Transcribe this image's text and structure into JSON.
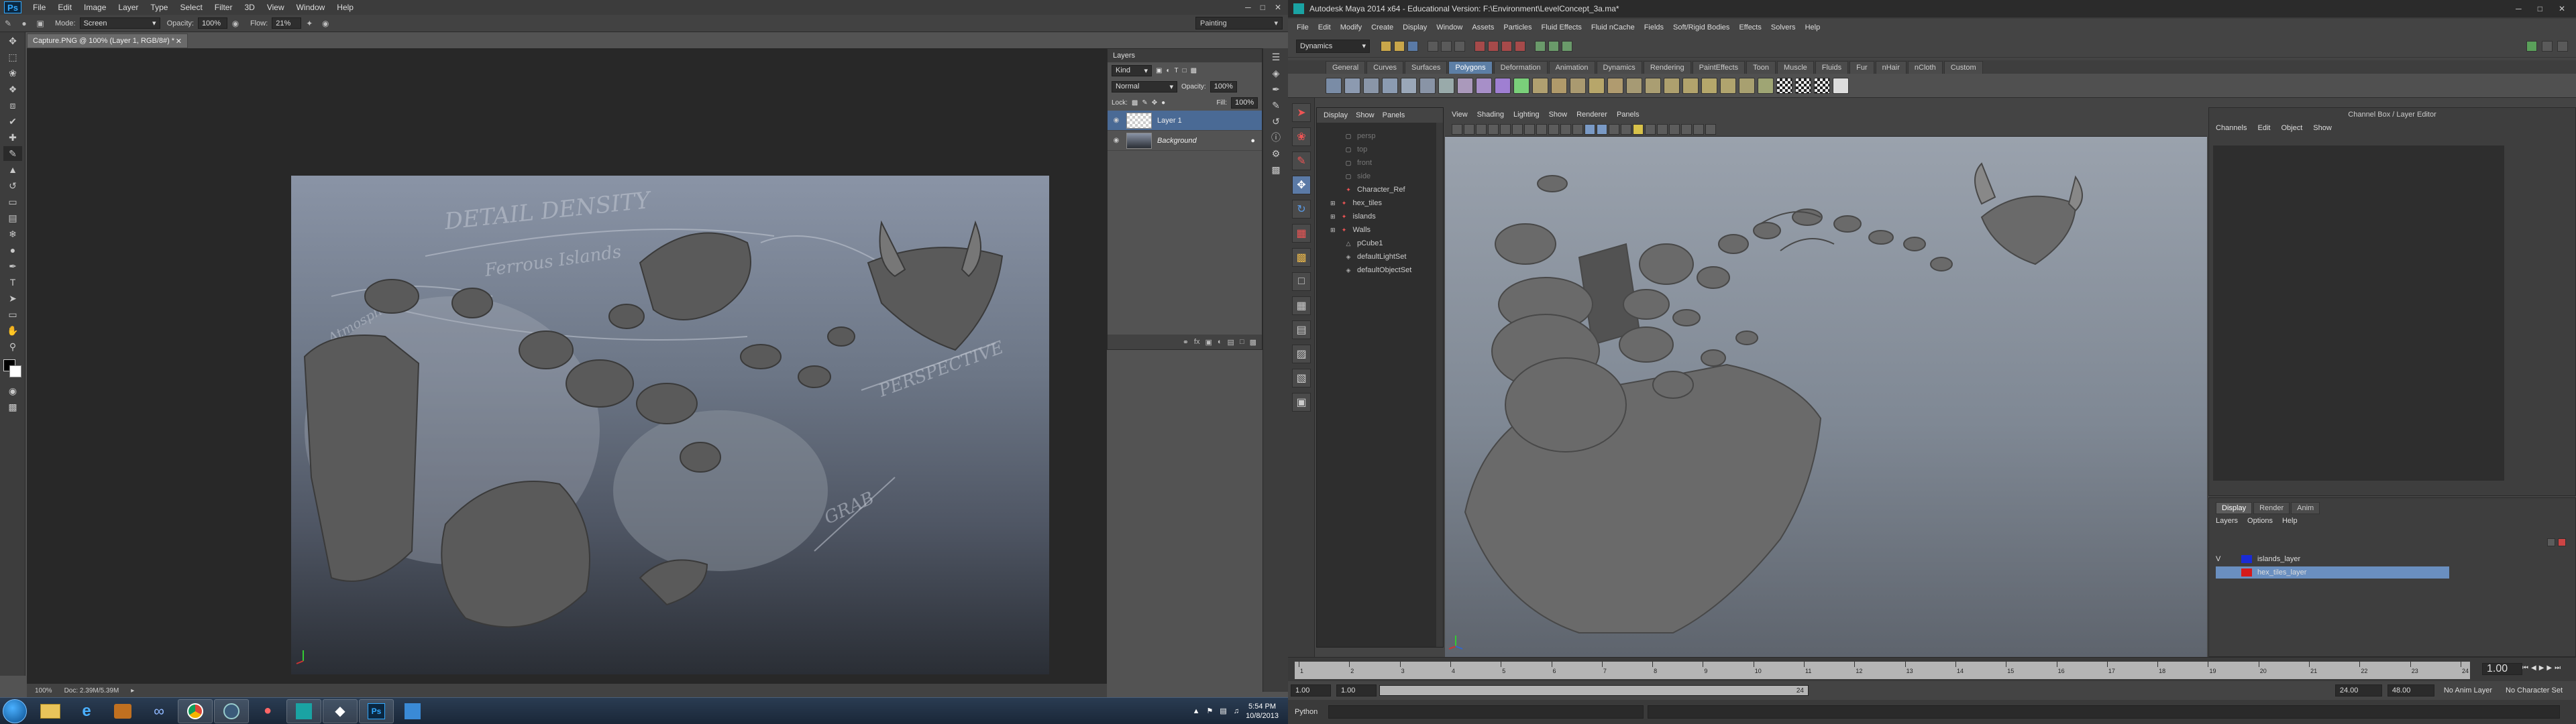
{
  "photoshop": {
    "logo": "Ps",
    "menu": [
      "File",
      "Edit",
      "Image",
      "Layer",
      "Type",
      "Select",
      "Filter",
      "3D",
      "View",
      "Window",
      "Help"
    ],
    "options": {
      "mode_label": "Mode:",
      "mode_value": "Screen",
      "opacity_label": "Opacity:",
      "opacity_value": "100%",
      "flow_label": "Flow:",
      "flow_value": "21%",
      "workspace": "Painting"
    },
    "document_tab": "Capture.PNG @ 100% (Layer 1, RGB/8#) *",
    "status": {
      "zoom": "100%",
      "doc": "Doc: 2.39M/5.39M"
    },
    "layers_panel": {
      "title": "Layers",
      "filter_kind": "Kind",
      "blend_mode": "Normal",
      "opacity_label": "Opacity:",
      "opacity_value": "100%",
      "lock_label": "Lock:",
      "fill_label": "Fill:",
      "fill_value": "100%",
      "layers": [
        {
          "name": "Layer 1"
        },
        {
          "name": "Background"
        }
      ]
    },
    "sketch_notes": [
      "DETAIL DENSITY",
      "Ferrous Islands",
      "PERSPECTIVE",
      "GRAB",
      "Atmosphere"
    ]
  },
  "maya": {
    "title": "Autodesk Maya 2014 x64 - Educational Version: F:\\Environment\\LevelConcept_3a.ma*",
    "menu": [
      "File",
      "Edit",
      "Modify",
      "Create",
      "Display",
      "Window",
      "Assets",
      "Particles",
      "Fluid Effects",
      "Fluid nCache",
      "Fields",
      "Soft/Rigid Bodies",
      "Effects",
      "Solvers",
      "Help"
    ],
    "mode": "Dynamics",
    "shelf_tabs": [
      "General",
      "Curves",
      "Surfaces",
      "Polygons",
      "Deformation",
      "Animation",
      "Dynamics",
      "Rendering",
      "PaintEffects",
      "Toon",
      "Muscle",
      "Fluids",
      "Fur",
      "nHair",
      "nCloth",
      "Custom"
    ],
    "active_shelf": "Polygons",
    "outliner": {
      "menu": [
        "Display",
        "Show",
        "Panels"
      ],
      "items": [
        {
          "name": "persp",
          "dim": true
        },
        {
          "name": "top",
          "dim": true
        },
        {
          "name": "front",
          "dim": true
        },
        {
          "name": "side",
          "dim": true
        },
        {
          "name": "Character_Ref",
          "dim": false
        },
        {
          "name": "hex_tiles",
          "dim": false
        },
        {
          "name": "islands",
          "dim": false
        },
        {
          "name": "Walls",
          "dim": false
        },
        {
          "name": "pCube1",
          "dim": false
        },
        {
          "name": "defaultLightSet",
          "dim": false
        },
        {
          "name": "defaultObjectSet",
          "dim": false
        }
      ]
    },
    "panel_menu": [
      "View",
      "Shading",
      "Lighting",
      "Show",
      "Renderer",
      "Panels"
    ],
    "channel_box": {
      "title": "Channel Box / Layer Editor",
      "menu": [
        "Channels",
        "Edit",
        "Object",
        "Show"
      ]
    },
    "layer_editor": {
      "tabs": [
        "Display",
        "Render",
        "Anim"
      ],
      "menu": [
        "Layers",
        "Options",
        "Help"
      ],
      "layers": [
        {
          "name": "islands_layer",
          "color": "#1a2bd6",
          "visible": "V"
        },
        {
          "name": "hex_tiles_layer",
          "color": "#d61a1a",
          "visible": ""
        }
      ]
    },
    "timeslider": {
      "ticks": [
        "1",
        "2",
        "3",
        "4",
        "5",
        "6",
        "7",
        "8",
        "9",
        "10",
        "11",
        "12",
        "13",
        "14",
        "15",
        "16",
        "17",
        "18",
        "19",
        "20",
        "21",
        "22",
        "23",
        "24"
      ],
      "current_frame": "1.00"
    },
    "range": {
      "start": "1.00",
      "inner_start": "1.00",
      "inner_end": "24",
      "end": "24.00",
      "total": "48.00",
      "anim_layer": "No Anim Layer",
      "char_set": "No Character Set"
    },
    "command": {
      "label": "Python"
    }
  },
  "taskbar": {
    "clock_time": "5:54 PM",
    "clock_date": "10/8/2013"
  }
}
